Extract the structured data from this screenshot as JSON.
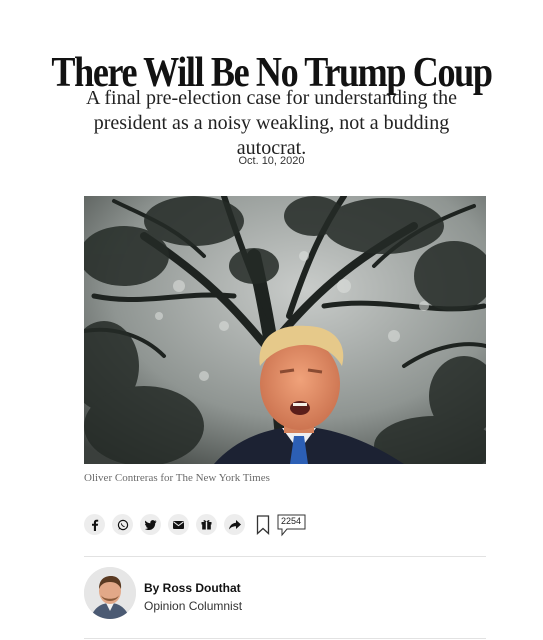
{
  "article": {
    "headline": "There Will Be No Trump Coup",
    "summary": "A final pre-election case for understanding the president as a noisy weakling, not a budding autocrat.",
    "date": "Oct. 10, 2020",
    "image_caption": "Oliver Contreras for The New York Times"
  },
  "share_bar": {
    "buttons": [
      {
        "icon": "facebook-icon"
      },
      {
        "icon": "whatsapp-icon"
      },
      {
        "icon": "twitter-icon"
      },
      {
        "icon": "email-icon"
      },
      {
        "icon": "gift-icon"
      },
      {
        "icon": "share-arrow-icon"
      }
    ],
    "bookmark_icon": "bookmark-icon",
    "comment_icon": "comment-bubble-icon",
    "comment_count": "2254"
  },
  "author": {
    "byline": "By Ross Douthat",
    "role": "Opinion Columnist",
    "avatar_icon": "author-avatar"
  },
  "colors": {
    "text": "#121212",
    "caption": "#6a6a6a",
    "button_bg": "#ededed",
    "divider": "#e2e2e2"
  }
}
